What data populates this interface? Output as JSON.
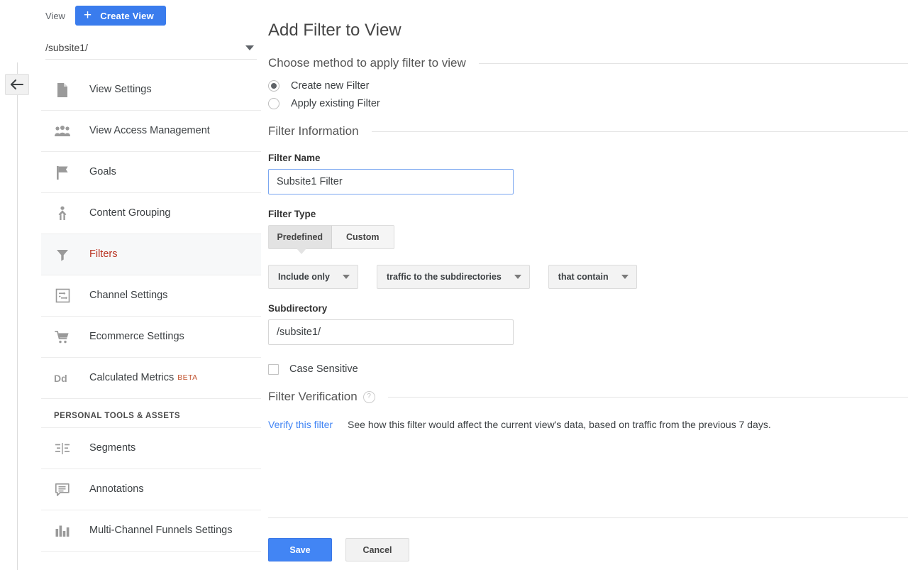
{
  "colors": {
    "brand_blue": "#4285f4",
    "create_view_blue": "#3a7ced",
    "selected_red": "#b93221",
    "beta_orange": "#c1532f",
    "link_blue": "#4285f4"
  },
  "sidebar": {
    "view_label": "View",
    "create_view_label": "Create View",
    "plus_glyph": "+",
    "selected_view": "/subsite1/",
    "items": [
      {
        "label": "View Settings",
        "icon": "document-icon",
        "selected": false
      },
      {
        "label": "View Access Management",
        "icon": "people-icon",
        "selected": false
      },
      {
        "label": "Goals",
        "icon": "flag-icon",
        "selected": false
      },
      {
        "label": "Content Grouping",
        "icon": "content-grouping-icon",
        "selected": false
      },
      {
        "label": "Filters",
        "icon": "funnel-icon",
        "selected": true
      },
      {
        "label": "Channel Settings",
        "icon": "channel-settings-icon",
        "selected": false
      },
      {
        "label": "Ecommerce Settings",
        "icon": "shopping-cart-icon",
        "selected": false
      },
      {
        "label": "Calculated Metrics",
        "icon": "dd-icon",
        "selected": false,
        "badge": "BETA"
      }
    ],
    "section_title": "PERSONAL TOOLS & ASSETS",
    "personal_items": [
      {
        "label": "Segments",
        "icon": "segments-icon"
      },
      {
        "label": "Annotations",
        "icon": "annotation-icon"
      },
      {
        "label": "Multi-Channel Funnels Settings",
        "icon": "bar-chart-icon"
      }
    ]
  },
  "main": {
    "page_title": "Add Filter to View",
    "method_section_title": "Choose method to apply filter to view",
    "method_options": [
      {
        "label": "Create new Filter",
        "checked": true
      },
      {
        "label": "Apply existing Filter",
        "checked": false
      }
    ],
    "filter_information_title": "Filter Information",
    "filter_name_label": "Filter Name",
    "filter_name_value": "Subsite1 Filter",
    "filter_name_placeholder": "",
    "filter_type_label": "Filter Type",
    "filter_type_tabs": [
      {
        "label": "Predefined",
        "active": true
      },
      {
        "label": "Custom",
        "active": false
      }
    ],
    "dropdowns": [
      {
        "value": "Include only",
        "name": "filter-verb"
      },
      {
        "value": "traffic to the subdirectories",
        "name": "filter-field"
      },
      {
        "value": "that contain",
        "name": "filter-match"
      }
    ],
    "subdirectory_label": "Subdirectory",
    "subdirectory_value": "/subsite1/",
    "subdirectory_placeholder": "",
    "case_sensitive_label": "Case Sensitive",
    "case_sensitive_checked": false,
    "verification_title": "Filter Verification",
    "help_glyph": "?",
    "verify_link": "Verify this filter",
    "verify_description": "See how this filter would affect the current view's data, based on traffic from the previous 7 days.",
    "save_label": "Save",
    "cancel_label": "Cancel"
  }
}
